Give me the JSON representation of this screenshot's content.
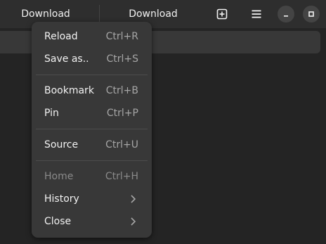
{
  "header": {
    "tabs": [
      {
        "label": "Download"
      },
      {
        "label": "Download"
      }
    ]
  },
  "menu": {
    "items": [
      {
        "label": "Reload",
        "shortcut": "Ctrl+R"
      },
      {
        "label": "Save as..",
        "shortcut": "Ctrl+S"
      },
      {
        "label": "Bookmark",
        "shortcut": "Ctrl+B"
      },
      {
        "label": "Pin",
        "shortcut": "Ctrl+P"
      },
      {
        "label": "Source",
        "shortcut": "Ctrl+U"
      },
      {
        "label": "Home",
        "shortcut": "Ctrl+H",
        "disabled": true
      },
      {
        "label": "History",
        "submenu": true
      },
      {
        "label": "Close",
        "submenu": true
      }
    ]
  },
  "icons": {
    "new_tab": "plus-box-icon",
    "menu": "hamburger-icon",
    "minimize": "minimize-icon",
    "maximize": "maximize-icon",
    "submenu": "chevron-right-icon"
  },
  "colors": {
    "background": "#242424",
    "headerbar": "#2e2e2e",
    "menu_bg": "#383838",
    "text": "#f2f2f2",
    "shortcut_text": "#a6a6a6",
    "disabled_text": "#8a8a8a"
  }
}
